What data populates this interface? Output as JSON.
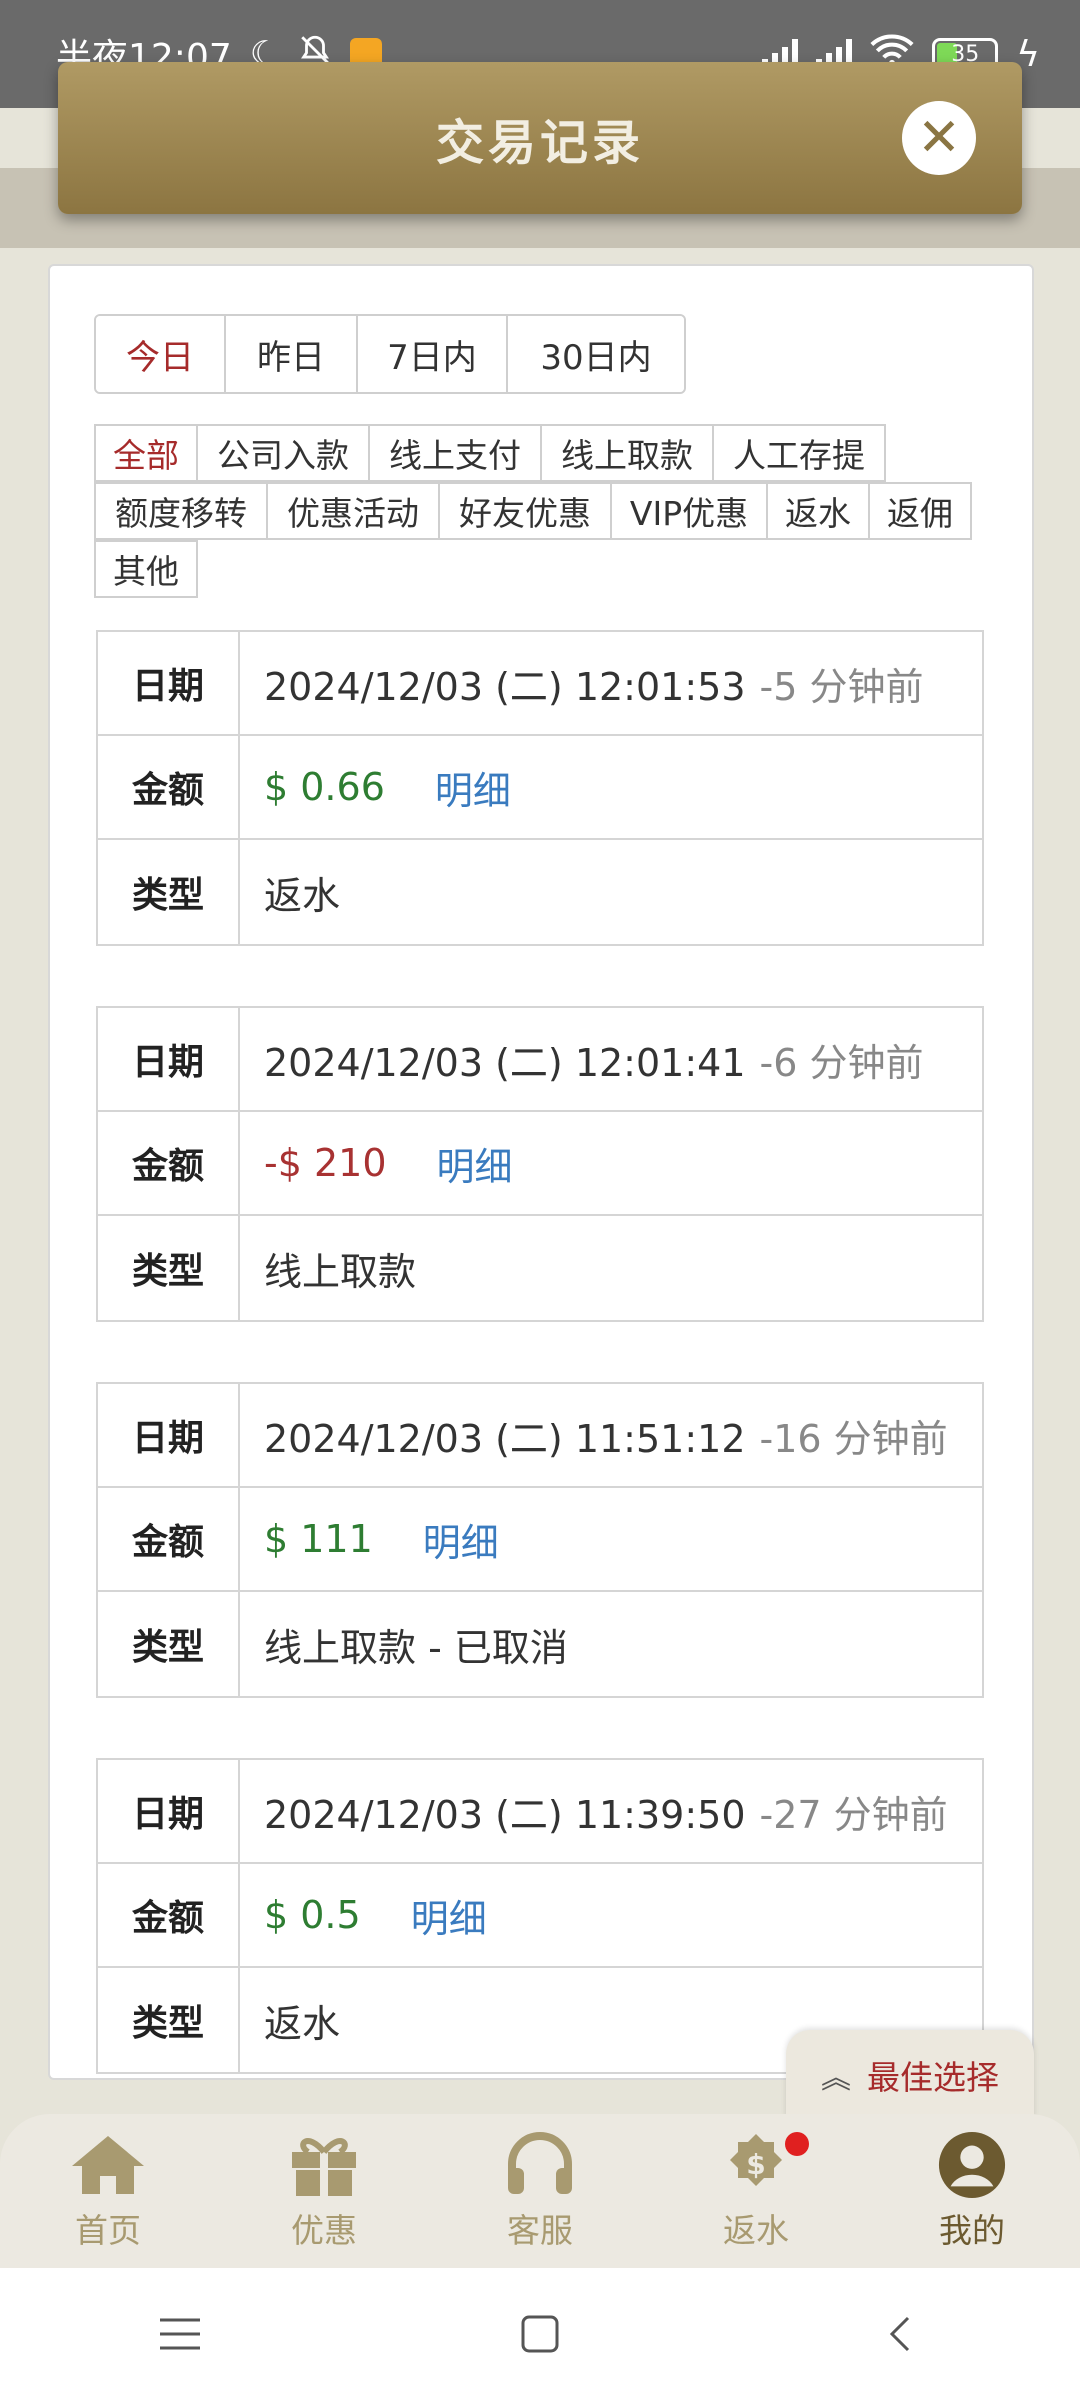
{
  "status_bar": {
    "time": "半夜12:07",
    "battery": "35"
  },
  "modal": {
    "title": "交易记录"
  },
  "date_tabs": [
    {
      "label": "今日",
      "active": true
    },
    {
      "label": "昨日",
      "active": false
    },
    {
      "label": "7日内",
      "active": false
    },
    {
      "label": "30日内",
      "active": false
    }
  ],
  "type_tags": {
    "row1": [
      "全部",
      "公司入款",
      "线上支付",
      "线上取款",
      "人工存提"
    ],
    "row2": [
      "额度移转",
      "优惠活动",
      "好友优惠",
      "VIP优惠",
      "返水",
      "返佣"
    ],
    "row3": [
      "其他"
    ],
    "active": "全部"
  },
  "field_labels": {
    "date": "日期",
    "amount": "金额",
    "type": "类型",
    "detail": "明细"
  },
  "records": [
    {
      "date": "2024/12/03 (二) 12:01:53",
      "ago": "-5 分钟前",
      "amount": "$ 0.66",
      "amount_sign": "positive",
      "type": "返水"
    },
    {
      "date": "2024/12/03 (二) 12:01:41",
      "ago": "-6 分钟前",
      "amount": "-$ 210",
      "amount_sign": "negative",
      "type": "线上取款"
    },
    {
      "date": "2024/12/03 (二) 11:51:12",
      "ago": "-16 分钟前",
      "amount": "$ 111",
      "amount_sign": "positive",
      "type": "线上取款 - 已取消"
    },
    {
      "date": "2024/12/03 (二) 11:39:50",
      "ago": "-27 分钟前",
      "amount": "$ 0.5",
      "amount_sign": "positive",
      "type": "返水"
    }
  ],
  "best_choice": "最佳选择",
  "bottom_nav": [
    {
      "label": "首页",
      "icon": "home-icon"
    },
    {
      "label": "优惠",
      "icon": "gift-icon"
    },
    {
      "label": "客服",
      "icon": "headset-icon"
    },
    {
      "label": "返水",
      "icon": "rebate-icon",
      "badge": true
    },
    {
      "label": "我的",
      "icon": "user-icon",
      "active": true
    }
  ],
  "colors": {
    "accent_red": "#a62b2b",
    "positive": "#2e7d32",
    "negative": "#a83232",
    "link": "#3a7bbf",
    "header_gold": "#9e8650"
  }
}
